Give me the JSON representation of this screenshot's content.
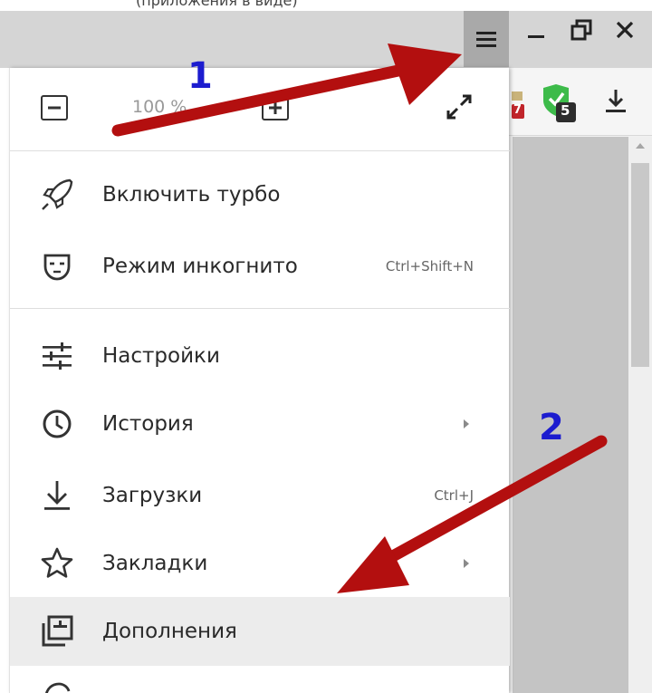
{
  "top_caption": "(приложения в виде)",
  "window_controls": {
    "menu_icon": "hamburger-icon",
    "minimize_icon": "minimize-icon",
    "restore_icon": "restore-icon",
    "close_icon": "close-icon"
  },
  "zoom": {
    "value": "100 %",
    "minus_icon": "minus-icon",
    "plus_icon": "plus-icon",
    "fullscreen_icon": "fullscreen-icon"
  },
  "menu": {
    "items": [
      {
        "label": "Включить турбо",
        "icon": "rocket-icon",
        "shortcut": "",
        "submenu": false
      },
      {
        "label": "Режим инкогнито",
        "icon": "incognito-mask-icon",
        "shortcut": "Ctrl+Shift+N",
        "submenu": false
      },
      {
        "label": "Настройки",
        "icon": "settings-sliders-icon",
        "shortcut": "",
        "submenu": false
      },
      {
        "label": "История",
        "icon": "clock-icon",
        "shortcut": "",
        "submenu": true
      },
      {
        "label": "Загрузки",
        "icon": "download-icon",
        "shortcut": "Ctrl+J",
        "submenu": false
      },
      {
        "label": "Закладки",
        "icon": "star-icon",
        "shortcut": "",
        "submenu": true
      },
      {
        "label": "Дополнения",
        "icon": "extensions-icon",
        "shortcut": "",
        "submenu": false
      }
    ],
    "highlighted_item": "Дополнения"
  },
  "annotations": {
    "label_1": "1",
    "label_2": "2",
    "arrow_color": "#b30f0f",
    "number_color": "#1c1ccf"
  },
  "toolbar": {
    "ext_badge_1": "7",
    "ext_badge_2": "5",
    "download_icon": "download-icon"
  }
}
